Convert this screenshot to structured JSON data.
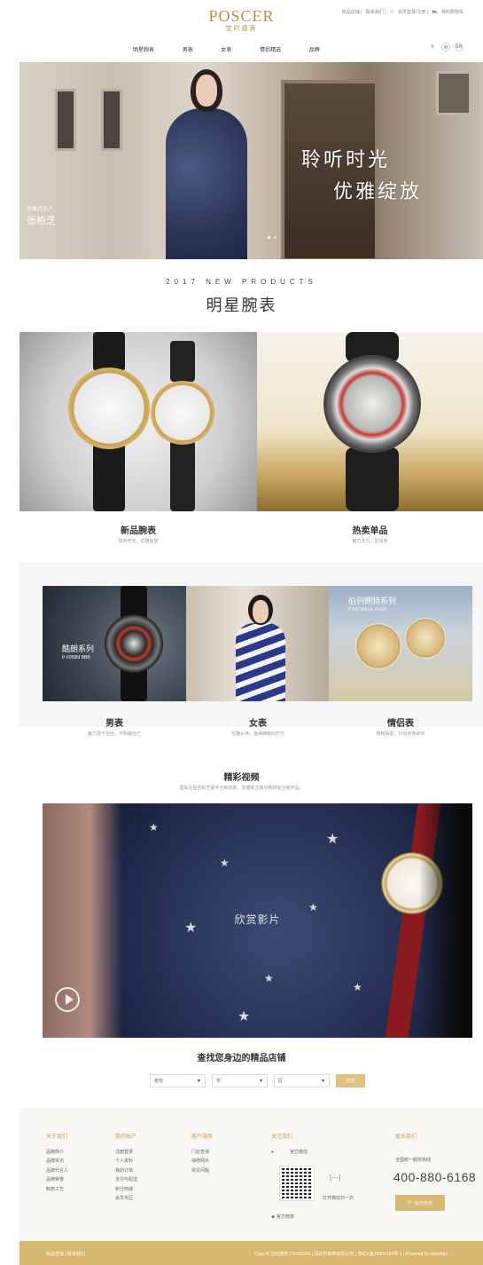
{
  "header": {
    "logo_en": "POSCER",
    "logo_cn": "宝时捷表",
    "toplinks": [
      "商品店铺",
      "联系我们",
      "会员登录/注册",
      "我的购物车"
    ],
    "nav": [
      "明星腕表",
      "男表",
      "女表",
      "情侣精选",
      "品牌"
    ],
    "lang": "EN"
  },
  "hero": {
    "line1": "聆听时光",
    "line2": "优雅绽放",
    "ambassador_small": "形象代言人",
    "ambassador_name": "张柏芝"
  },
  "new_products": {
    "subtitle": "2017 NEW PRODUCTS",
    "title": "明星腕表",
    "items": [
      {
        "title": "新品腕表",
        "sub": "聆听时光，优雅绽放"
      },
      {
        "title": "热卖单品",
        "sub": "魅力非凡，型出色"
      }
    ]
  },
  "series": {
    "labels": [
      {
        "name": "酷朗系列",
        "code": "P-6058M BBB"
      },
      {
        "name": "伯列朗特系列",
        "code": "P-6073M/LK.VVGD"
      }
    ],
    "items": [
      {
        "title": "男表",
        "sub": "魅力源于自信，不羁做自己"
      },
      {
        "title": "女表",
        "sub": "优雅女神，值得拥有好时光"
      },
      {
        "title": "情侣表",
        "sub": "相知相爱，只给你我的你"
      }
    ]
  },
  "video": {
    "title": "精彩视频",
    "sub": "国际巨星张柏芝联手全新形象，双重新主题诠释时尚全新作品。",
    "label": "欣赏影片"
  },
  "store_finder": {
    "title": "查找您身边的精品店铺",
    "province": "省份",
    "city": "市",
    "district": "区",
    "button": "查询"
  },
  "footer": {
    "cols": [
      {
        "h": "关于我们",
        "items": [
          "品牌简介",
          "品牌资讯",
          "品牌代言人",
          "品牌荣誉",
          "制表工艺"
        ]
      },
      {
        "h": "我的账户",
        "items": [
          "注册登录",
          "个人资料",
          "我的订单",
          "支付与配送",
          "积分商城",
          "会员专区"
        ]
      },
      {
        "h": "客户服务",
        "items": [
          "门店查询",
          "保修网点",
          "常见问题"
        ]
      },
      {
        "h": "关注我们",
        "items": [
          "官方微信",
          "官方微博"
        ]
      }
    ],
    "scan": "打开微信扫一扫",
    "contact_h": "联系我们",
    "hotline_label": "全国统一服务热线",
    "hotline": "400-880-6168",
    "service": "在线咨询",
    "bottom_left": "商品查询 | 联系我们",
    "bottom_right": "Copy ® 宝时捷表 | POSCER | 深圳市钟表有限公司 | 粤ICP备16004154号-1 | Powered by wanchen"
  }
}
